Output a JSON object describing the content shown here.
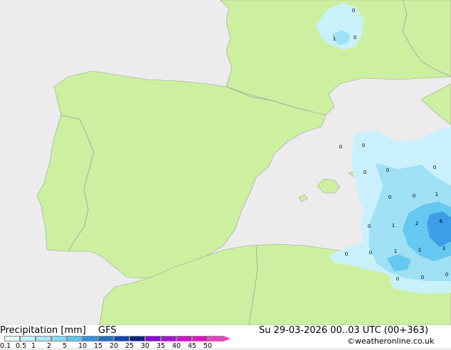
{
  "title": {
    "main": "Precipitation [mm]",
    "model": "GFS",
    "datetime": "Su 29-03-2026 00..03 UTC (00+363)",
    "credit": "©weatheronline.co.uk"
  },
  "colors": {
    "sea": "#ececec",
    "land": "#ccf0a0",
    "border": "#9e9e9e",
    "precip_light": "#c8f0ff",
    "precip_mid": "#a0e0f5",
    "precip_heavy": "#64c8f0",
    "precip_core": "#3c9ee6"
  },
  "legend": {
    "ticks": [
      "0.1",
      "0.5",
      "1",
      "2",
      "5",
      "10",
      "15",
      "20",
      "25",
      "30",
      "35",
      "40",
      "45",
      "50"
    ],
    "swatches": [
      "#e6fafe",
      "#c8f2fc",
      "#a8e8fa",
      "#82dcf5",
      "#5ac8f0",
      "#3296e1",
      "#1e6ed2",
      "#1446b4",
      "#0a1e96",
      "#8c00dc",
      "#b400e6",
      "#dc00dc",
      "#ff00c8",
      "#ff3cc8"
    ]
  },
  "map_values": [
    {
      "text": "0"
    },
    {
      "text": "1"
    },
    {
      "text": "0"
    },
    {
      "text": "0"
    },
    {
      "text": "0"
    },
    {
      "text": "0"
    },
    {
      "text": "0"
    },
    {
      "text": "0"
    },
    {
      "text": "0"
    },
    {
      "text": "0"
    },
    {
      "text": "1"
    },
    {
      "text": "0"
    },
    {
      "text": "1"
    },
    {
      "text": "2"
    },
    {
      "text": "6"
    },
    {
      "text": "0"
    },
    {
      "text": "0"
    },
    {
      "text": "1"
    },
    {
      "text": "1"
    },
    {
      "text": "3"
    },
    {
      "text": "0"
    },
    {
      "text": "0"
    },
    {
      "text": "0"
    }
  ]
}
